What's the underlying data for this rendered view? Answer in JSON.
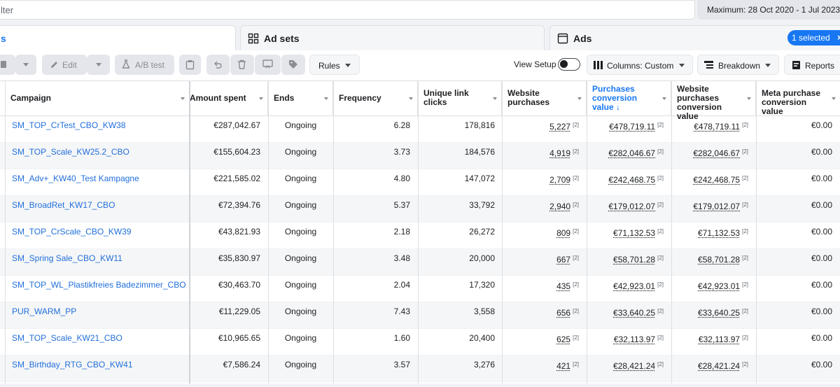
{
  "filter": {
    "placeholder": "lter"
  },
  "date_range": "Maximum: 28 Oct 2020 - 1 Jul 2023",
  "tabs": [
    {
      "label": "s",
      "icon": "campaigns-icon",
      "active": true
    },
    {
      "label": "Ad sets",
      "icon": "grid-icon",
      "active": false
    },
    {
      "label": "Ads",
      "icon": "ad-square-icon",
      "active": false
    }
  ],
  "selected_badge": {
    "label": "1 selected",
    "close": "×"
  },
  "toolbar": {
    "edit": "Edit",
    "ab_test": "A/B test",
    "rules": "Rules",
    "view_setup": "View Setup",
    "columns": "Columns: Custom",
    "breakdown": "Breakdown",
    "reports": "Reports"
  },
  "columns": [
    "Campaign",
    "Amount spent",
    "Ends",
    "Frequency",
    "Unique link clicks",
    "Website purchases",
    "Purchases conversion value ↓",
    "Website purchases conversion value",
    "Meta purchase conversion value"
  ],
  "rows": [
    {
      "campaign": "SM_TOP_CrTest_CBO_KW38",
      "spent": "€287,042.67",
      "ends": "Ongoing",
      "frequency": "6.28",
      "clicks": "178,816",
      "purchases": "5,227",
      "purchase_value": "€478,719.11",
      "web_value": "€478,719.11",
      "meta_value": "€0.00"
    },
    {
      "campaign": "SM_TOP_Scale_KW25.2_CBO",
      "spent": "€155,604.23",
      "ends": "Ongoing",
      "frequency": "3.73",
      "clicks": "184,576",
      "purchases": "4,919",
      "purchase_value": "€282,046.67",
      "web_value": "€282,046.67",
      "meta_value": "€0.00"
    },
    {
      "campaign": "SM_Adv+_KW40_Test Kampagne",
      "spent": "€221,585.02",
      "ends": "Ongoing",
      "frequency": "4.80",
      "clicks": "147,072",
      "purchases": "2,709",
      "purchase_value": "€242,468.75",
      "web_value": "€242,468.75",
      "meta_value": "€0.00"
    },
    {
      "campaign": "SM_BroadRet_KW17_CBO",
      "spent": "€72,394.76",
      "ends": "Ongoing",
      "frequency": "5.37",
      "clicks": "33,792",
      "purchases": "2,940",
      "purchase_value": "€179,012.07",
      "web_value": "€179,012.07",
      "meta_value": "€0.00"
    },
    {
      "campaign": "SM_TOP_CrScale_CBO_KW39",
      "spent": "€43,821.93",
      "ends": "Ongoing",
      "frequency": "2.18",
      "clicks": "26,272",
      "purchases": "809",
      "purchase_value": "€71,132.53",
      "web_value": "€71,132.53",
      "meta_value": "€0.00"
    },
    {
      "campaign": "SM_Spring Sale_CBO_KW11",
      "spent": "€35,830.97",
      "ends": "Ongoing",
      "frequency": "3.48",
      "clicks": "20,000",
      "purchases": "667",
      "purchase_value": "€58,701.28",
      "web_value": "€58,701.28",
      "meta_value": "€0.00"
    },
    {
      "campaign": "SM_TOP_WL_Plastikfreies Badezimmer_CBO...",
      "spent": "€30,463.70",
      "ends": "Ongoing",
      "frequency": "2.04",
      "clicks": "17,320",
      "purchases": "435",
      "purchase_value": "€42,923.01",
      "web_value": "€42,923.01",
      "meta_value": "€0.00"
    },
    {
      "campaign": "PUR_WARM_PP",
      "spent": "€11,229.05",
      "ends": "Ongoing",
      "frequency": "7.43",
      "clicks": "3,558",
      "purchases": "656",
      "purchase_value": "€33,640.25",
      "web_value": "€33,640.25",
      "meta_value": "€0.00"
    },
    {
      "campaign": "SM_TOP_Scale_KW21_CBO",
      "spent": "€10,965.65",
      "ends": "Ongoing",
      "frequency": "1.60",
      "clicks": "20,400",
      "purchases": "625",
      "purchase_value": "€32,113.97",
      "web_value": "€32,113.97",
      "meta_value": "€0.00"
    },
    {
      "campaign": "SM_Birthday_RTG_CBO_KW41",
      "spent": "€7,586.24",
      "ends": "Ongoing",
      "frequency": "3.57",
      "clicks": "3,276",
      "purchases": "421",
      "purchase_value": "€28,421.24",
      "web_value": "€28,421.24",
      "meta_value": "€0.00"
    }
  ],
  "footnote_mark": "[2]",
  "colors": {
    "accent": "#1877f2",
    "link": "#216fdb"
  }
}
